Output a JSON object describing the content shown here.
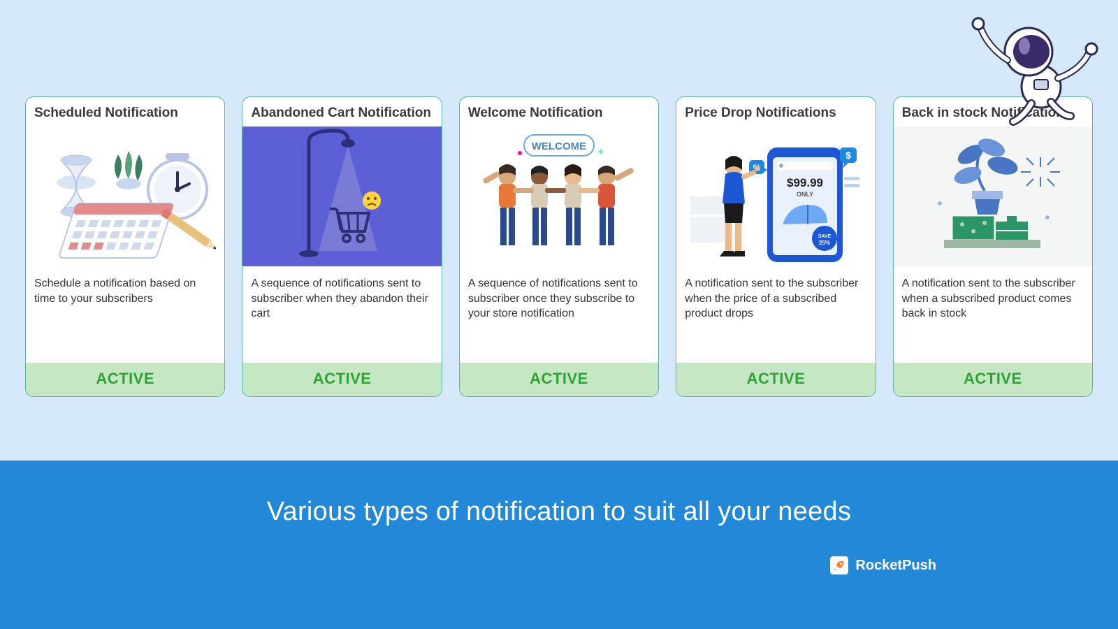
{
  "cards": [
    {
      "title": "Scheduled Notification",
      "desc": "Schedule a notification based on time to your subscribers",
      "status": "ACTIVE"
    },
    {
      "title": "Abandoned Cart Notification",
      "desc": "A sequence of notifications sent to subscriber when they abandon their cart",
      "status": "ACTIVE"
    },
    {
      "title": "Welcome Notification",
      "desc": "A sequence of notifications sent to subscriber once they subscribe to your store notification",
      "status": "ACTIVE",
      "badgeText": "WELCOME"
    },
    {
      "title": "Price Drop Notifications",
      "desc": "A notification sent to the subscriber when the price of a subscribed product drops",
      "status": "ACTIVE",
      "priceText": "$99.99",
      "onlyText": "ONLY",
      "saveText": "SAVE 25%",
      "dollarSign": "$",
      "percentSign": "%"
    },
    {
      "title": "Back in stock Notification",
      "desc": "A notification sent to the subscriber when a subscribed product comes back in stock",
      "status": "ACTIVE"
    }
  ],
  "banner": {
    "heading": "Various types of notification to suit all your needs"
  },
  "brand": {
    "name": "RocketPush"
  }
}
